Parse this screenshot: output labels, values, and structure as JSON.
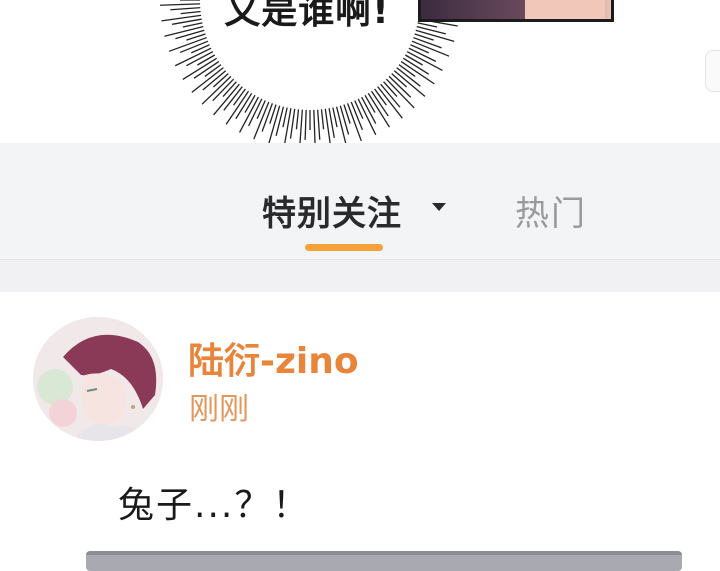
{
  "comic": {
    "bubble_text": "又是谁啊!"
  },
  "tabs": {
    "active": "特别关注",
    "inactive": "热门"
  },
  "post": {
    "username": "陆衍-zino",
    "timestamp": "刚刚",
    "content": "兔子...？！"
  },
  "colors": {
    "accent": "#f4a13a",
    "username": "#e8853a",
    "timestamp": "#e1985a"
  }
}
